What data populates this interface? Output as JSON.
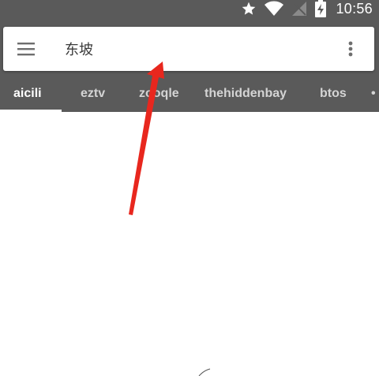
{
  "status_bar": {
    "time": "10:56",
    "icons": [
      "star-icon",
      "wifi-icon",
      "no-sim-icon",
      "battery-charging-icon"
    ]
  },
  "search": {
    "value": "东坡",
    "menu_icon": "hamburger-menu-icon",
    "more_icon": "more-vertical-icon"
  },
  "tabs": [
    {
      "label": "aicili",
      "active": true
    },
    {
      "label": "eztv",
      "active": false
    },
    {
      "label": "zooqle",
      "active": false
    },
    {
      "label": "thehiddenbay",
      "active": false
    },
    {
      "label": "btos",
      "active": false
    }
  ],
  "colors": {
    "toolbar": "#5a5a5a",
    "arrow": "#e8271e",
    "background": "#ffffff"
  }
}
